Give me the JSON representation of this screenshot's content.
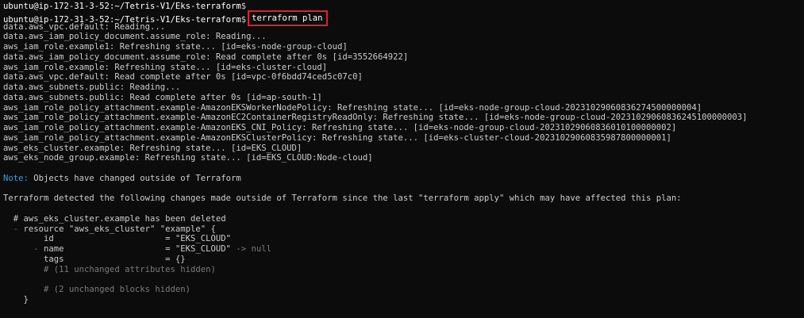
{
  "terminal": {
    "prompt": {
      "user_host": "ubuntu@ip-172-31-3-52",
      "sep": ":",
      "path": "~/Tetris-V1/Eks-terraform",
      "symbol": "$"
    },
    "command": "terraform plan",
    "highlight_color": "#e0202a",
    "log_lines": [
      "data.aws_vpc.default: Reading...",
      "data.aws_iam_policy_document.assume_role: Reading...",
      "aws_iam_role.example1: Refreshing state... [id=eks-node-group-cloud]",
      "data.aws_iam_policy_document.assume_role: Read complete after 0s [id=3552664922]",
      "aws_iam_role.example: Refreshing state... [id=eks-cluster-cloud]",
      "data.aws_vpc.default: Read complete after 0s [id=vpc-0f6bdd74ced5c07c0]",
      "data.aws_subnets.public: Reading...",
      "data.aws_subnets.public: Read complete after 0s [id=ap-south-1]",
      "aws_iam_role_policy_attachment.example-AmazonEKSWorkerNodePolicy: Refreshing state... [id=eks-node-group-cloud-20231029060836274500000004]",
      "aws_iam_role_policy_attachment.example-AmazonEC2ContainerRegistryReadOnly: Refreshing state... [id=eks-node-group-cloud-20231029060836245100000003]",
      "aws_iam_role_policy_attachment.example-AmazonEKS_CNI_Policy: Refreshing state... [id=eks-node-group-cloud-20231029060836010100000002]",
      "aws_iam_role_policy_attachment.example-AmazonEKSClusterPolicy: Refreshing state... [id=eks-cluster-cloud-20231029060835987800000001]",
      "aws_eks_cluster.example: Refreshing state... [id=EKS_CLOUD]",
      "aws_eks_node_group.example: Refreshing state... [id=EKS_CLOUD:Node-cloud]"
    ],
    "note_label": "Note:",
    "note_text": " Objects have changed outside of Terraform",
    "detected_text": "Terraform detected the following changes made outside of Terraform since the last \"terraform apply\" which may have affected this plan:",
    "diff": {
      "comment": "  # aws_eks_cluster.example has been deleted",
      "resource_minus": "  - ",
      "resource_text": "resource \"aws_eks_cluster\" \"example\" {",
      "id_line": "        id                      = \"EKS_CLOUD\"",
      "name_minus": "      - ",
      "name_text": "name                    = \"EKS_CLOUD\" ",
      "name_null": "-> null",
      "tags_line": "        tags                    = {}",
      "hidden_attrs": "        # (11 unchanged attributes hidden)",
      "hidden_blocks": "        # (2 unchanged blocks hidden)",
      "close": "    }"
    }
  }
}
